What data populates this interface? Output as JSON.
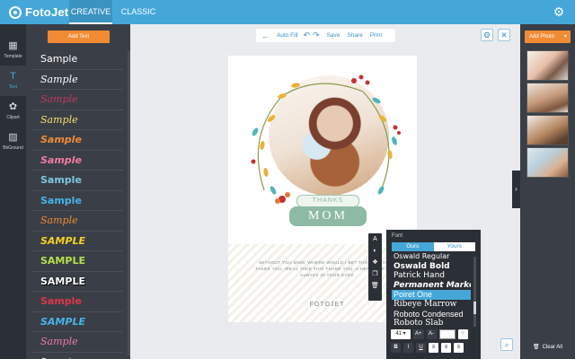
{
  "app": {
    "name": "FotoJet"
  },
  "nav": {
    "tabs": [
      {
        "label": "CREATIVE",
        "active": true
      },
      {
        "label": "CLASSIC",
        "active": false
      }
    ]
  },
  "rail": {
    "items": [
      {
        "label": "Template",
        "icon": "template-icon"
      },
      {
        "label": "Text",
        "icon": "text-icon",
        "active": true
      },
      {
        "label": "Clipart",
        "icon": "clipart-icon"
      },
      {
        "label": "BkGround",
        "icon": "background-icon"
      }
    ]
  },
  "text_panel": {
    "add_label": "Add Text",
    "samples": [
      {
        "text": "Sample",
        "color": "#ffffff",
        "style": "plain"
      },
      {
        "text": "Sample",
        "color": "#ffffff",
        "style": "script"
      },
      {
        "text": "Sample",
        "color": "#c0375a",
        "style": "script"
      },
      {
        "text": "Sample",
        "color": "#f3e06a",
        "style": "script"
      },
      {
        "text": "Sample",
        "color": "#f08b33",
        "style": "bold-italic"
      },
      {
        "text": "Sample",
        "color": "#f07aa3",
        "style": "bold-italic"
      },
      {
        "text": "Sample",
        "color": "#7ec8e3",
        "style": "bold"
      },
      {
        "text": "Sample",
        "color": "#45b5e8",
        "style": "bold"
      },
      {
        "text": "Sample",
        "color": "#f08b33",
        "style": "italic"
      },
      {
        "text": "SAMPLE",
        "color": "#f5d026",
        "style": "bold-italic"
      },
      {
        "text": "SAMPLE",
        "color": "#b5e04a",
        "style": "bold"
      },
      {
        "text": "SAMPLE",
        "color": "#ffffff",
        "style": "bold-outline"
      },
      {
        "text": "Sample",
        "color": "#e0344a",
        "style": "bold"
      },
      {
        "text": "SAMPLE",
        "color": "#45b5e8",
        "style": "bold-italic"
      },
      {
        "text": "Sample",
        "color": "#f07aa3",
        "style": "script"
      },
      {
        "text": "Sample",
        "color": "#ffffff",
        "style": "plain"
      }
    ]
  },
  "toolbar": {
    "auto_fill": "Auto Fill",
    "save": "Save",
    "share": "Share",
    "print": "Print"
  },
  "card": {
    "subtitle": "THANKS",
    "title": "MOM",
    "message": "WITHOUT YOU MOM, WHERE WOULD I BE? THOUGH I HATE TAKES YOU, WE'LL TAKE THIS THANK YOU, A HEAVENLY LOOK ALWAYS IN YOUR EYES",
    "brand": "FOTOJET"
  },
  "font_panel": {
    "title": "Font",
    "tabs": [
      {
        "label": "Ours",
        "active": true
      },
      {
        "label": "Yours",
        "active": false
      }
    ],
    "fonts": [
      {
        "name": "Oswald Regular",
        "selected": false
      },
      {
        "name": "Oswald Bold",
        "selected": false
      },
      {
        "name": "Patrick Hand",
        "selected": false
      },
      {
        "name": "Permanent Marker",
        "selected": false
      },
      {
        "name": "Poiret One",
        "selected": true
      },
      {
        "name": "Ribeye Marrow",
        "selected": false
      },
      {
        "name": "Roboto Condensed",
        "selected": false
      },
      {
        "name": "Roboto Slab",
        "selected": false
      }
    ],
    "size_value": "41",
    "size_up": "A+",
    "size_down": "A-",
    "bold": "B",
    "italic": "I",
    "underline": "U"
  },
  "right_panel": {
    "add_photo": "Add Photo",
    "clear_all": "Clear All",
    "thumb_count": 4
  },
  "colors": {
    "accent": "#45a7d8",
    "orange": "#f08b33",
    "dark": "#2b2f36",
    "panel": "#3a3f47",
    "mint": "#8db9a5"
  }
}
